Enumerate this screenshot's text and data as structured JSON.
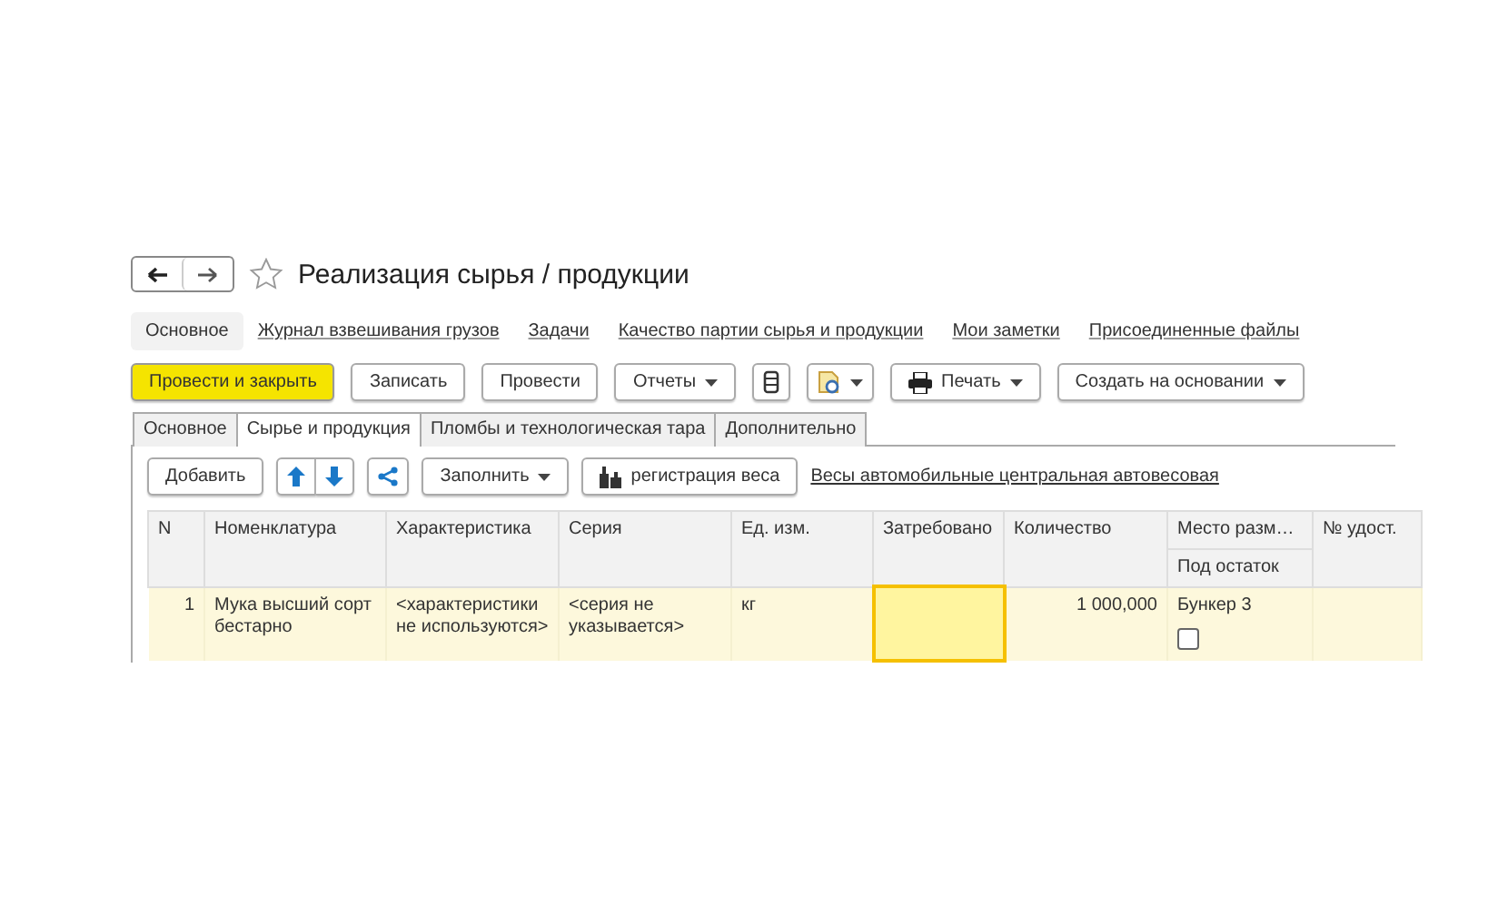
{
  "window": {
    "title": "Реализация сырья / продукции",
    "favorite": false
  },
  "nav": [
    {
      "label": "Основное",
      "selected": true
    },
    {
      "label": "Журнал взвешивания грузов",
      "selected": false
    },
    {
      "label": "Задачи",
      "selected": false
    },
    {
      "label": "Качество партии сырья и продукции",
      "selected": false
    },
    {
      "label": "Мои заметки",
      "selected": false
    },
    {
      "label": "Присоединенные файлы",
      "selected": false
    }
  ],
  "toolbar": [
    {
      "kind": "primary",
      "label": "Провести и закрыть"
    },
    {
      "kind": "plain",
      "label": "Записать"
    },
    {
      "kind": "plain",
      "label": "Провести"
    },
    {
      "kind": "menu",
      "label": "Отчеты"
    },
    {
      "kind": "stack"
    },
    {
      "kind": "docmenu"
    },
    {
      "kind": "print",
      "label": "Печать"
    },
    {
      "kind": "menu",
      "label": "Создать на основании"
    }
  ],
  "tabs": [
    {
      "label": "Основное",
      "selected": false
    },
    {
      "label": "Сырье и продукция",
      "selected": true
    },
    {
      "label": "Пломбы и технологическая тара",
      "selected": false
    },
    {
      "label": "Дополнительно",
      "selected": false
    }
  ],
  "table_toolbar": [
    {
      "kind": "plain",
      "label": "Добавить"
    },
    {
      "kind": "arrows"
    },
    {
      "kind": "share"
    },
    {
      "kind": "menu",
      "label": "Заполнить"
    },
    {
      "kind": "scale",
      "label": "регистрация веса"
    },
    {
      "kind": "link",
      "label": "Весы автомобильные центральная автовесовая"
    }
  ],
  "table": {
    "columns": [
      {
        "label": "N"
      },
      {
        "label": "Номенклатура"
      },
      {
        "label": "Характеристика"
      },
      {
        "label": "Серия"
      },
      {
        "label": "Ед. изм."
      },
      {
        "label": "Затребовано"
      },
      {
        "label": "Количество"
      },
      {
        "label": "Место разм…",
        "sub": "Под остаток"
      },
      {
        "label": "№ удост."
      }
    ],
    "rows": [
      {
        "selected": true,
        "n": "1",
        "item": "Мука высший сорт бестарно",
        "characteristic": "<характеристики не используются>",
        "series": "<серия не указывается>",
        "unit": "кг",
        "requested": "",
        "quantity": "1 000,000",
        "place": "Бункер 3",
        "under_balance": false
      }
    ]
  }
}
